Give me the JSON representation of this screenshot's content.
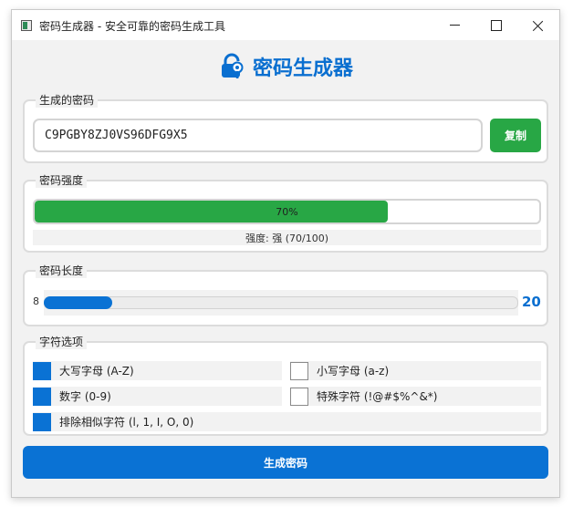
{
  "window": {
    "title": "密码生成器 - 安全可靠的密码生成工具"
  },
  "header": {
    "title": "密码生成器",
    "icon": "key-lock-icon"
  },
  "password_group": {
    "label": "生成的密码",
    "value": "C9PGBY8ZJ0VS96DFG9X5",
    "copy_label": "复制"
  },
  "strength_group": {
    "label": "密码强度",
    "percent": 70,
    "percent_text": "70%",
    "description": "强度: 强 (70/100)"
  },
  "length_group": {
    "label": "密码长度",
    "min": 8,
    "max": 32,
    "value": 20,
    "min_text": "8",
    "value_text": "20"
  },
  "options_group": {
    "label": "字符选项",
    "options": [
      {
        "label": "大写字母 (A-Z)",
        "checked": true
      },
      {
        "label": "小写字母 (a-z)",
        "checked": false
      },
      {
        "label": "数字 (0-9)",
        "checked": true
      },
      {
        "label": "特殊字符 (!@#$%^&*)",
        "checked": false
      },
      {
        "label": "排除相似字符 (l, 1, I, O, 0)",
        "checked": true
      }
    ]
  },
  "generate_label": "生成密码",
  "colors": {
    "accent": "#0a72d4",
    "success": "#28a745"
  }
}
